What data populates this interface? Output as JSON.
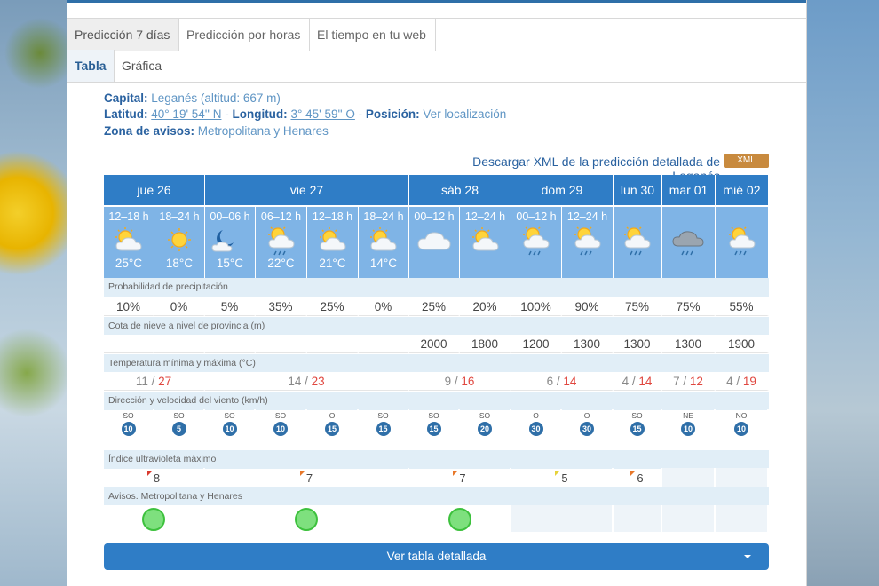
{
  "tabs": [
    "Predicción 7 días",
    "Predicción por horas",
    "El tiempo en tu web"
  ],
  "subtabs": [
    "Tabla",
    "Gráfica"
  ],
  "info": {
    "capital_label": "Capital:",
    "capital_value": "Leganés (altitud: 667 m)",
    "lat_label": "Latitud:",
    "lat_value": "40° 19' 54'' N",
    "sep1": " - ",
    "lon_label": "Longitud:",
    "lon_value": "3° 45' 59'' O",
    "sep2": " - ",
    "pos_label": "Posición:",
    "pos_value": "Ver localización",
    "zone_label": "Zona de avisos:",
    "zone_value": "Metropolitana y Henares"
  },
  "xml": {
    "text": "Descargar XML de la predicción detallada de Leganés",
    "badge": "XML"
  },
  "days": [
    "jue 26",
    "vie 27",
    "sáb 28",
    "dom 29",
    "lun 30",
    "mar 01",
    "mié 02"
  ],
  "slots": [
    {
      "time": "12–18 h",
      "temp": "25°C",
      "icon": "sun-cloud-icon"
    },
    {
      "time": "18–24 h",
      "temp": "18°C",
      "icon": "sun-icon"
    },
    {
      "time": "00–06 h",
      "temp": "15°C",
      "icon": "moon-cloud-icon"
    },
    {
      "time": "06–12 h",
      "temp": "22°C",
      "icon": "sun-cloud-rain-icon"
    },
    {
      "time": "12–18 h",
      "temp": "21°C",
      "icon": "sun-cloud-icon"
    },
    {
      "time": "18–24 h",
      "temp": "14°C",
      "icon": "sun-cloud-icon"
    },
    {
      "time": "00–12 h",
      "temp": "",
      "icon": "cloud-icon"
    },
    {
      "time": "12–24 h",
      "temp": "",
      "icon": "sun-cloud-icon"
    },
    {
      "time": "00–12 h",
      "temp": "",
      "icon": "sun-cloud-rain-icon"
    },
    {
      "time": "12–24 h",
      "temp": "",
      "icon": "sun-cloud-rain-icon"
    },
    {
      "time": "",
      "temp": "",
      "icon": "sun-cloud-rain-icon"
    },
    {
      "time": "",
      "temp": "",
      "icon": "dark-cloud-rain-icon"
    },
    {
      "time": "",
      "temp": "",
      "icon": "sun-cloud-rain-icon"
    }
  ],
  "sections": {
    "precip": "Probabilidad de precipitación",
    "snow": "Cota de nieve a nivel de provincia (m)",
    "temp": "Temperatura mínima y máxima (°C)",
    "wind": "Dirección y velocidad del viento (km/h)",
    "uv": "Índice ultravioleta máximo",
    "avisos": "Avisos. Metropolitana y Henares"
  },
  "precip": [
    "10%",
    "0%",
    "5%",
    "35%",
    "25%",
    "0%",
    "25%",
    "20%",
    "100%",
    "90%",
    "75%",
    "75%",
    "55%"
  ],
  "snow": [
    "",
    "",
    "",
    "",
    "",
    "",
    "2000",
    "1800",
    "1200",
    "1300",
    "1300",
    "1300",
    "1900"
  ],
  "temps": [
    {
      "min": "11",
      "max": "27"
    },
    {
      "min": "14",
      "max": "23"
    },
    {
      "min": "9",
      "max": "16"
    },
    {
      "min": "6",
      "max": "14"
    },
    {
      "min": "4",
      "max": "14"
    },
    {
      "min": "7",
      "max": "12"
    },
    {
      "min": "4",
      "max": "19"
    }
  ],
  "wind": [
    {
      "dir": "SO",
      "spd": "10"
    },
    {
      "dir": "SO",
      "spd": "5"
    },
    {
      "dir": "SO",
      "spd": "10"
    },
    {
      "dir": "SO",
      "spd": "10"
    },
    {
      "dir": "O",
      "spd": "15"
    },
    {
      "dir": "SO",
      "spd": "15"
    },
    {
      "dir": "SO",
      "spd": "15"
    },
    {
      "dir": "SO",
      "spd": "20"
    },
    {
      "dir": "O",
      "spd": "30"
    },
    {
      "dir": "O",
      "spd": "30"
    },
    {
      "dir": "SO",
      "spd": "15"
    },
    {
      "dir": "NE",
      "spd": "10"
    },
    {
      "dir": "NO",
      "spd": "10"
    }
  ],
  "uv": [
    "8",
    "7",
    "7",
    "5",
    "6",
    "",
    ""
  ],
  "uv_colors": [
    "#d93a2e",
    "#e8782a",
    "#e8782a",
    "#e6d23a",
    "#e8782a",
    "",
    ""
  ],
  "button": "Ver tabla detallada"
}
